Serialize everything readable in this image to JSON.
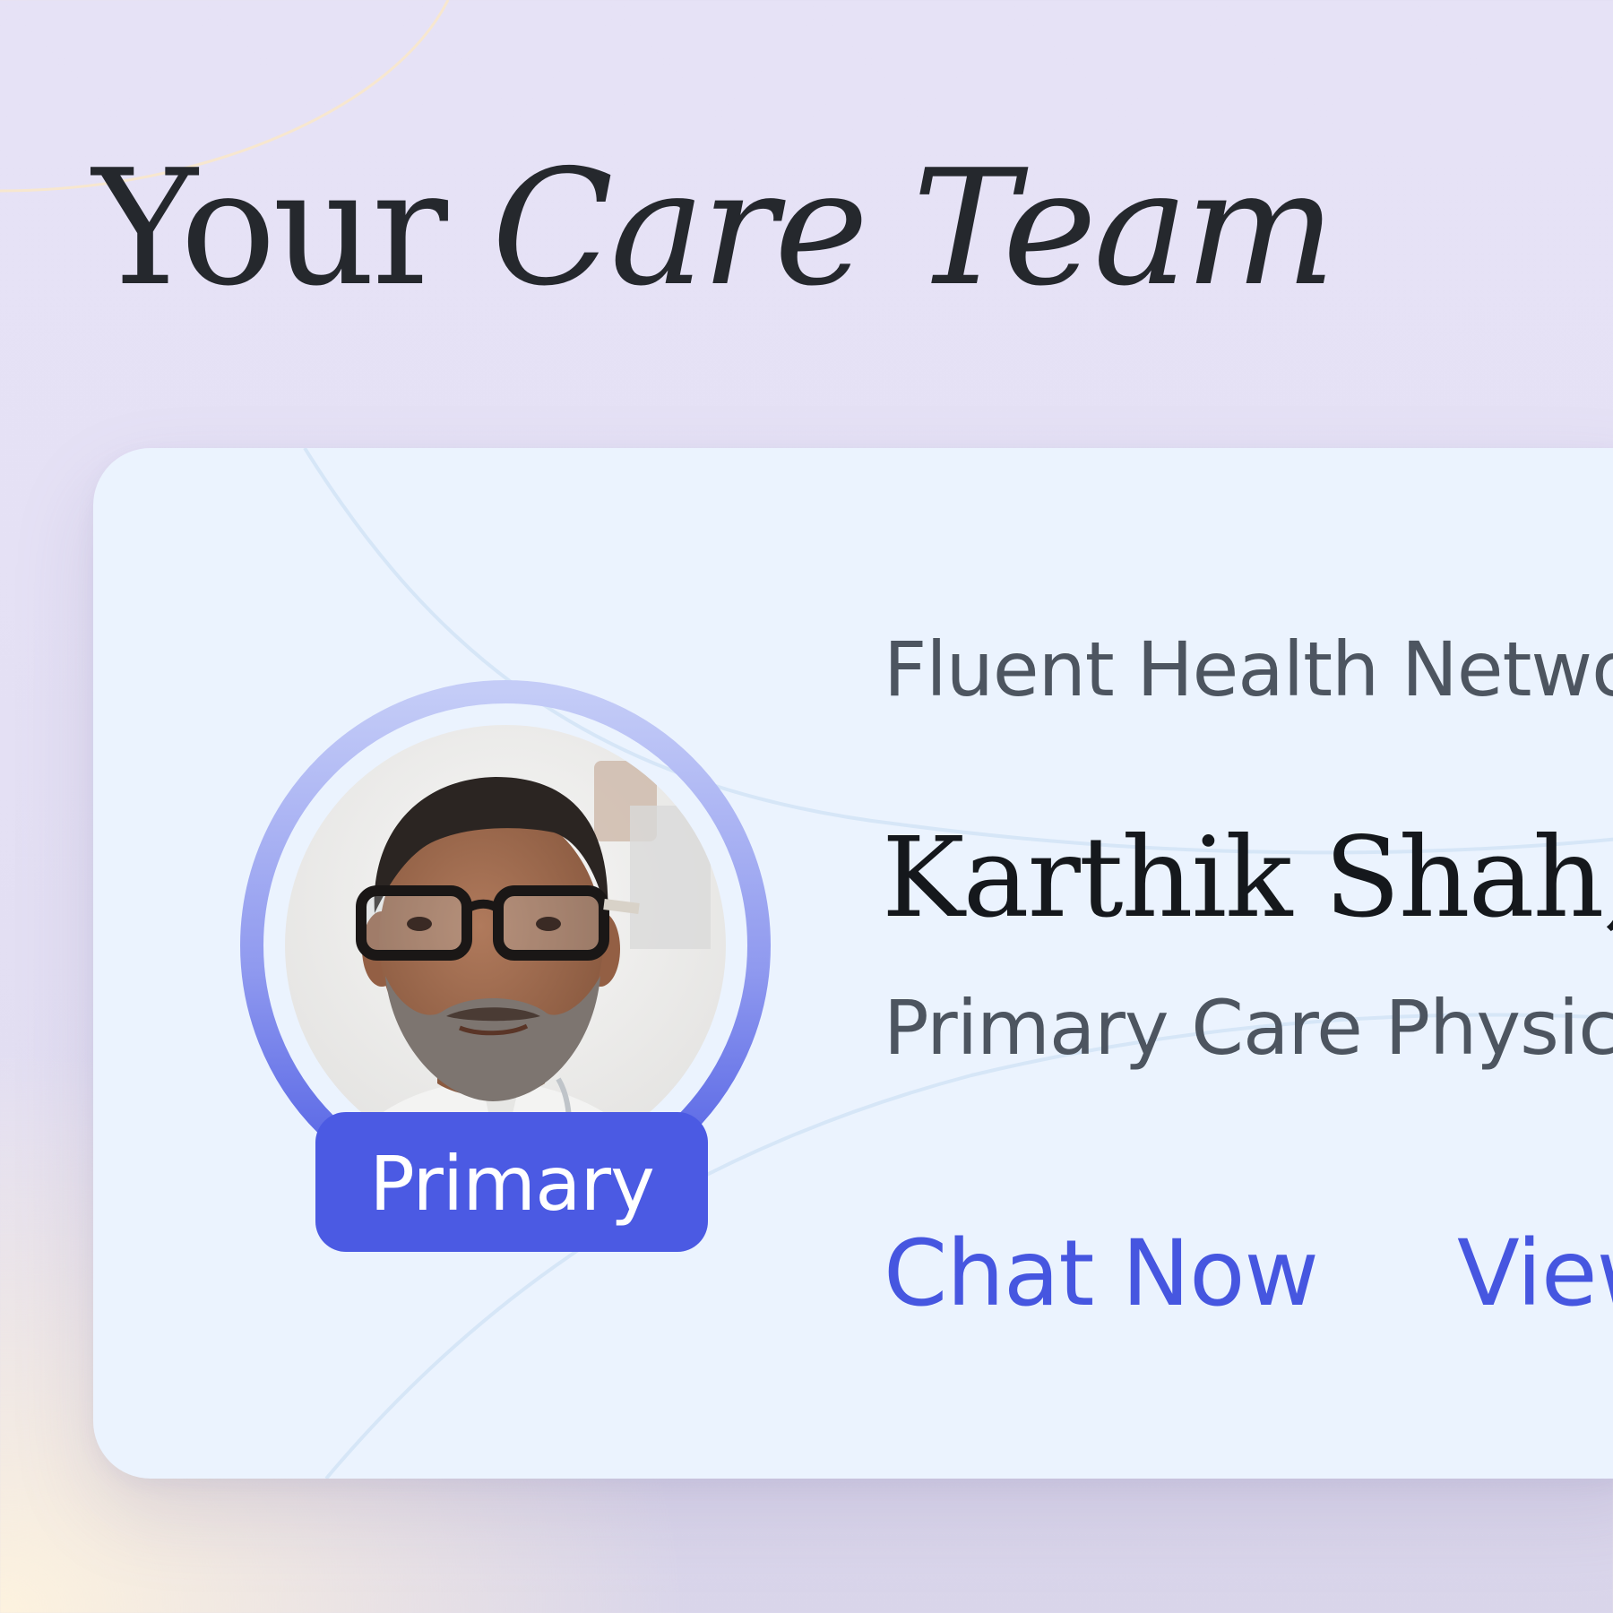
{
  "header": {
    "title_plain": "Your",
    "title_emphasis": "Care Team"
  },
  "care_team": {
    "primary_provider": {
      "organization": "Fluent Health Network",
      "name": "Karthik Shah,",
      "role": "Primary Care Physician",
      "badge_label": "Primary",
      "actions": {
        "chat_label": "Chat Now",
        "view_label": "View"
      }
    }
  },
  "colors": {
    "accent": "#4b5ae3",
    "link": "#4656e0",
    "card_background": "#ebf3fe",
    "title_text": "#25282d",
    "secondary_text": "#4d5560"
  }
}
